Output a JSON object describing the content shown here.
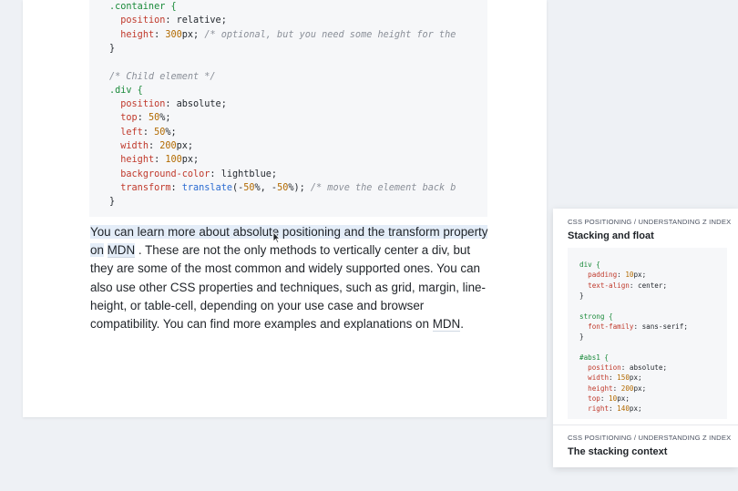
{
  "code": {
    "lines": [
      [
        {
          "t": ".container {",
          "c": "sel"
        }
      ],
      [
        {
          "t": "  ",
          "c": ""
        },
        {
          "t": "position",
          "c": "prop"
        },
        {
          "t": ": relative;",
          "c": ""
        }
      ],
      [
        {
          "t": "  ",
          "c": ""
        },
        {
          "t": "height",
          "c": "prop"
        },
        {
          "t": ": ",
          "c": ""
        },
        {
          "t": "300",
          "c": "num"
        },
        {
          "t": "px; ",
          "c": ""
        },
        {
          "t": "/* optional, but you need some height for the",
          "c": "com"
        }
      ],
      [
        {
          "t": "}",
          "c": ""
        }
      ],
      [
        {
          "t": "",
          "c": ""
        }
      ],
      [
        {
          "t": "/* Child element */",
          "c": "com"
        }
      ],
      [
        {
          "t": ".div {",
          "c": "sel"
        }
      ],
      [
        {
          "t": "  ",
          "c": ""
        },
        {
          "t": "position",
          "c": "prop"
        },
        {
          "t": ": absolute;",
          "c": ""
        }
      ],
      [
        {
          "t": "  ",
          "c": ""
        },
        {
          "t": "top",
          "c": "prop"
        },
        {
          "t": ": ",
          "c": ""
        },
        {
          "t": "50",
          "c": "num"
        },
        {
          "t": "%;",
          "c": ""
        }
      ],
      [
        {
          "t": "  ",
          "c": ""
        },
        {
          "t": "left",
          "c": "prop"
        },
        {
          "t": ": ",
          "c": ""
        },
        {
          "t": "50",
          "c": "num"
        },
        {
          "t": "%;",
          "c": ""
        }
      ],
      [
        {
          "t": "  ",
          "c": ""
        },
        {
          "t": "width",
          "c": "prop"
        },
        {
          "t": ": ",
          "c": ""
        },
        {
          "t": "200",
          "c": "num"
        },
        {
          "t": "px;",
          "c": ""
        }
      ],
      [
        {
          "t": "  ",
          "c": ""
        },
        {
          "t": "height",
          "c": "prop"
        },
        {
          "t": ": ",
          "c": ""
        },
        {
          "t": "100",
          "c": "num"
        },
        {
          "t": "px;",
          "c": ""
        }
      ],
      [
        {
          "t": "  ",
          "c": ""
        },
        {
          "t": "background-color",
          "c": "prop"
        },
        {
          "t": ": lightblue;",
          "c": ""
        }
      ],
      [
        {
          "t": "  ",
          "c": ""
        },
        {
          "t": "transform",
          "c": "prop"
        },
        {
          "t": ": ",
          "c": ""
        },
        {
          "t": "translate",
          "c": "fn"
        },
        {
          "t": "(-",
          "c": ""
        },
        {
          "t": "50",
          "c": "num"
        },
        {
          "t": "%, -",
          "c": ""
        },
        {
          "t": "50",
          "c": "num"
        },
        {
          "t": "%); ",
          "c": ""
        },
        {
          "t": "/* move the element back b",
          "c": "com"
        }
      ],
      [
        {
          "t": "}",
          "c": ""
        }
      ]
    ]
  },
  "paragraph": {
    "part1": "You can learn more about absolute positioning and the transform property on",
    "link1": "MDN",
    "part2": ". These are not the only methods to vertically center a div, but they are some of the most common and widely supported ones. You can also use other CSS properties and techniques, such as grid, margin, line-height, or table-cell, depending on your use case and browser compatibility. You can find more examples and explanations on",
    "link2": "MDN",
    "part3": "."
  },
  "side_card": {
    "first": {
      "crumb": "CSS POSITIONING / UNDERSTANDING Z INDEX",
      "title": "Stacking and float",
      "code_lines": [
        [
          {
            "t": "div {",
            "c": "sel"
          }
        ],
        [
          {
            "t": "  ",
            "c": ""
          },
          {
            "t": "padding",
            "c": "prop"
          },
          {
            "t": ": ",
            "c": ""
          },
          {
            "t": "10",
            "c": "num"
          },
          {
            "t": "px;",
            "c": ""
          }
        ],
        [
          {
            "t": "  ",
            "c": ""
          },
          {
            "t": "text-align",
            "c": "prop"
          },
          {
            "t": ": center;",
            "c": ""
          }
        ],
        [
          {
            "t": "}",
            "c": ""
          }
        ],
        [
          {
            "t": "",
            "c": ""
          }
        ],
        [
          {
            "t": "strong {",
            "c": "sel"
          }
        ],
        [
          {
            "t": "  ",
            "c": ""
          },
          {
            "t": "font-family",
            "c": "prop"
          },
          {
            "t": ": sans-serif;",
            "c": ""
          }
        ],
        [
          {
            "t": "}",
            "c": ""
          }
        ],
        [
          {
            "t": "",
            "c": ""
          }
        ],
        [
          {
            "t": "#abs1 {",
            "c": "sel"
          }
        ],
        [
          {
            "t": "  ",
            "c": ""
          },
          {
            "t": "position",
            "c": "prop"
          },
          {
            "t": ": absolute;",
            "c": ""
          }
        ],
        [
          {
            "t": "  ",
            "c": ""
          },
          {
            "t": "width",
            "c": "prop"
          },
          {
            "t": ": ",
            "c": ""
          },
          {
            "t": "150",
            "c": "num"
          },
          {
            "t": "px;",
            "c": ""
          }
        ],
        [
          {
            "t": "  ",
            "c": ""
          },
          {
            "t": "height",
            "c": "prop"
          },
          {
            "t": ": ",
            "c": ""
          },
          {
            "t": "200",
            "c": "num"
          },
          {
            "t": "px;",
            "c": ""
          }
        ],
        [
          {
            "t": "  ",
            "c": ""
          },
          {
            "t": "top",
            "c": "prop"
          },
          {
            "t": ": ",
            "c": ""
          },
          {
            "t": "10",
            "c": "num"
          },
          {
            "t": "px;",
            "c": ""
          }
        ],
        [
          {
            "t": "  ",
            "c": ""
          },
          {
            "t": "right",
            "c": "prop"
          },
          {
            "t": ": ",
            "c": ""
          },
          {
            "t": "140",
            "c": "num"
          },
          {
            "t": "px;",
            "c": ""
          }
        ]
      ]
    },
    "second": {
      "crumb": "CSS POSITIONING / UNDERSTANDING Z INDEX",
      "title": "The stacking context"
    }
  },
  "icons": {
    "cursor": "text-cursor-icon"
  },
  "colors": {
    "selector": "#1a8a3a",
    "property": "#c0392b",
    "number": "#b26a00",
    "comment": "#8a8f98",
    "function": "#2a6bd1",
    "highlight": "#e4edf8"
  }
}
